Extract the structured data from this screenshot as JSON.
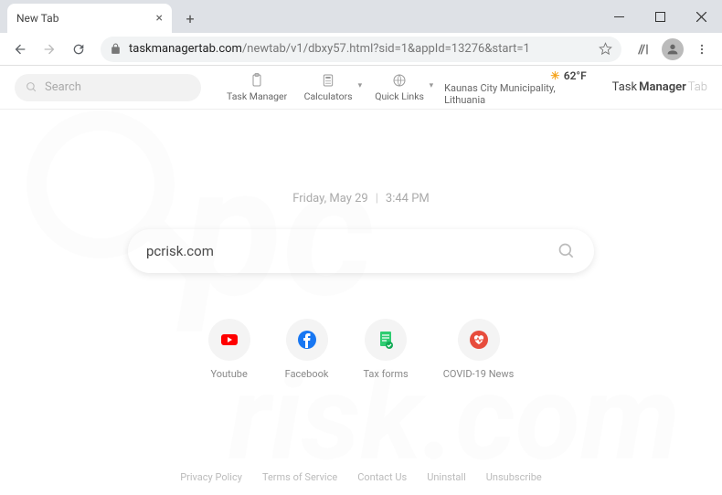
{
  "browser": {
    "tab_title": "New Tab",
    "url_host": "taskmanagertab.com",
    "url_path": "/newtab/v1/dbxy57.html?sid=1&appId=13276&start=1"
  },
  "topbar": {
    "search_placeholder": "Search",
    "items": [
      {
        "label": "Task Manager"
      },
      {
        "label": "Calculators"
      },
      {
        "label": "Quick Links"
      }
    ],
    "weather_temp": "62°F",
    "weather_loc": "Kaunas City Municipality, Lithuania",
    "brand1": "Task",
    "brand2": "Manager",
    "brand3": "Tab"
  },
  "datetime": {
    "date": "Friday, May 29",
    "time": "3:44 PM"
  },
  "search": {
    "value": "pcrisk.com"
  },
  "shortcuts": [
    {
      "label": "Youtube"
    },
    {
      "label": "Facebook"
    },
    {
      "label": "Tax forms"
    },
    {
      "label": "COVID-19 News"
    }
  ],
  "footer": [
    "Privacy Policy",
    "Terms of Service",
    "Contact Us",
    "Uninstall",
    "Unsubscribe"
  ]
}
